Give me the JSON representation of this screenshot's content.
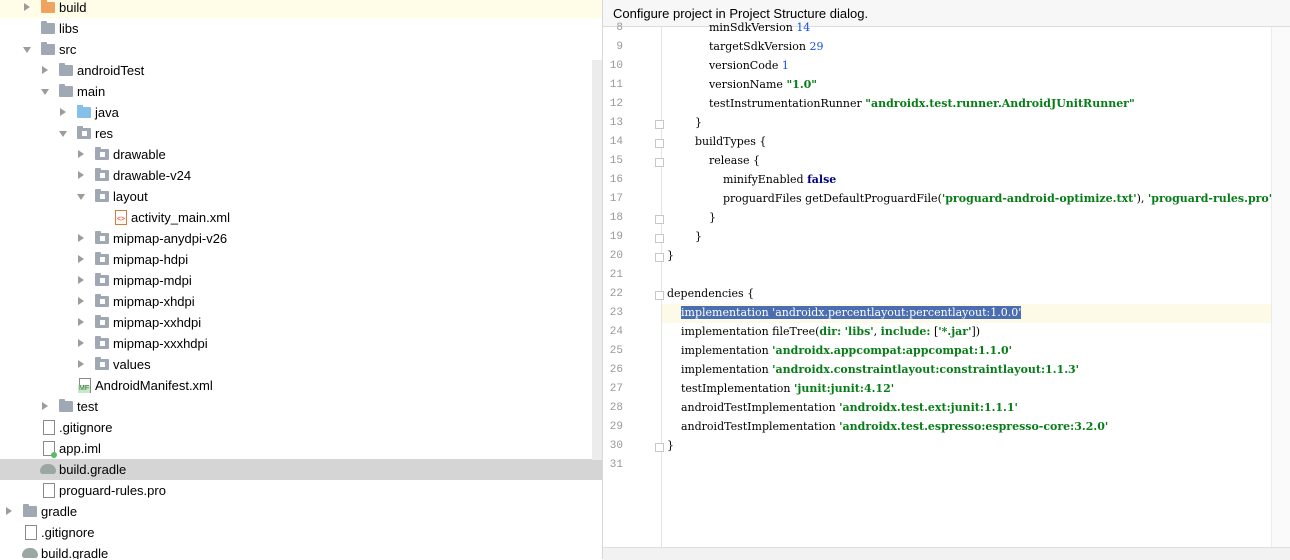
{
  "tree": {
    "items": [
      {
        "label": "build",
        "icon": "orange-folder-icon"
      },
      {
        "label": "libs",
        "icon": "folder-icon"
      },
      {
        "label": "src",
        "icon": "folder-icon"
      },
      {
        "label": "androidTest",
        "icon": "folder-icon"
      },
      {
        "label": "main",
        "icon": "folder-icon"
      },
      {
        "label": "java",
        "icon": "source-folder-icon"
      },
      {
        "label": "res",
        "icon": "resource-folder-icon"
      },
      {
        "label": "drawable",
        "icon": "folder-icon"
      },
      {
        "label": "drawable-v24",
        "icon": "folder-icon"
      },
      {
        "label": "layout",
        "icon": "folder-icon"
      },
      {
        "label": "activity_main.xml",
        "icon": "xml-file-icon"
      },
      {
        "label": "mipmap-anydpi-v26",
        "icon": "folder-icon"
      },
      {
        "label": "mipmap-hdpi",
        "icon": "folder-icon"
      },
      {
        "label": "mipmap-mdpi",
        "icon": "folder-icon"
      },
      {
        "label": "mipmap-xhdpi",
        "icon": "folder-icon"
      },
      {
        "label": "mipmap-xxhdpi",
        "icon": "folder-icon"
      },
      {
        "label": "mipmap-xxxhdpi",
        "icon": "folder-icon"
      },
      {
        "label": "values",
        "icon": "folder-icon"
      },
      {
        "label": "AndroidManifest.xml",
        "icon": "manifest-file-icon"
      },
      {
        "label": "test",
        "icon": "folder-icon"
      },
      {
        "label": ".gitignore",
        "icon": "file-icon"
      },
      {
        "label": "app.iml",
        "icon": "iml-file-icon"
      },
      {
        "label": "build.gradle",
        "icon": "gradle-icon"
      },
      {
        "label": "proguard-rules.pro",
        "icon": "file-icon"
      },
      {
        "label": "gradle",
        "icon": "folder-icon"
      },
      {
        "label": ".gitignore",
        "icon": "file-icon"
      },
      {
        "label": "build.gradle",
        "icon": "gradle-icon"
      }
    ]
  },
  "editor": {
    "banner": "Configure project in Project Structure dialog.",
    "lines": [
      {
        "n": "8",
        "text": "            minSdkVersion 14"
      },
      {
        "n": "9",
        "text": "            targetSdkVersion 29"
      },
      {
        "n": "10",
        "text": "            versionCode 1"
      },
      {
        "n": "11",
        "text": "            versionName \"1.0\""
      },
      {
        "n": "12",
        "text": "            testInstrumentationRunner \"androidx.test.runner.AndroidJUnitRunner\""
      },
      {
        "n": "13",
        "text": "        }"
      },
      {
        "n": "14",
        "text": "        buildTypes {"
      },
      {
        "n": "15",
        "text": "            release {"
      },
      {
        "n": "16",
        "text": "                minifyEnabled false"
      },
      {
        "n": "17",
        "text": "                proguardFiles getDefaultProguardFile('proguard-android-optimize.txt'), 'proguard-rules.pro'"
      },
      {
        "n": "18",
        "text": "            }"
      },
      {
        "n": "19",
        "text": "        }"
      },
      {
        "n": "20",
        "text": "}"
      },
      {
        "n": "21",
        "text": ""
      },
      {
        "n": "22",
        "text": "dependencies {"
      },
      {
        "n": "23",
        "text": "    implementation 'androidx.percentlayout:percentlayout:1.0.0'"
      },
      {
        "n": "24",
        "text": "    implementation fileTree(dir: 'libs', include: ['*.jar'])"
      },
      {
        "n": "25",
        "text": "    implementation 'androidx.appcompat:appcompat:1.1.0'"
      },
      {
        "n": "26",
        "text": "    implementation 'androidx.constraintlayout:constraintlayout:1.1.3'"
      },
      {
        "n": "27",
        "text": "    testImplementation 'junit:junit:4.12'"
      },
      {
        "n": "28",
        "text": "    androidTestImplementation 'androidx.test.ext:junit:1.1.1'"
      },
      {
        "n": "29",
        "text": "    androidTestImplementation 'androidx.test.espresso:espresso-core:3.2.0'"
      },
      {
        "n": "30",
        "text": "}"
      },
      {
        "n": "31",
        "text": ""
      }
    ]
  }
}
